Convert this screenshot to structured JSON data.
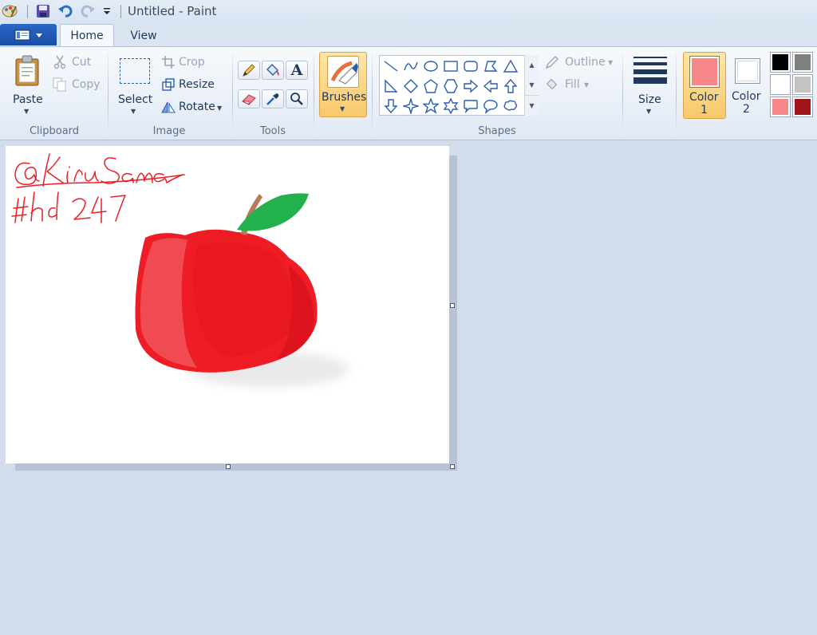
{
  "window": {
    "title": "Untitled - Paint"
  },
  "tabs": [
    {
      "label": "Home"
    },
    {
      "label": "View"
    }
  ],
  "clipboard": {
    "group_label": "Clipboard",
    "paste_label": "Paste",
    "cut_label": "Cut",
    "copy_label": "Copy"
  },
  "image": {
    "group_label": "Image",
    "select_label": "Select",
    "crop_label": "Crop",
    "resize_label": "Resize",
    "rotate_label": "Rotate"
  },
  "tools": {
    "group_label": "Tools"
  },
  "brushes": {
    "label": "Brushes"
  },
  "shapes": {
    "group_label": "Shapes",
    "outline_label": "Outline",
    "fill_label": "Fill"
  },
  "size": {
    "label": "Size"
  },
  "colors": {
    "color1": {
      "label_line1": "Color",
      "label_line2": "1",
      "value": "#f7868a"
    },
    "color2": {
      "label_line1": "Color",
      "label_line2": "2",
      "value": "#ffffff"
    },
    "palette": [
      "#000000",
      "#7f7f7f",
      "#ffffff",
      "#c3c3c3",
      "#f7868a",
      "#a0141c"
    ]
  },
  "canvas": {
    "signature_line1": "@KiruSama",
    "signature_line2": "#hd247",
    "apple_color": "#ee1c24",
    "leaf_color": "#22b14c",
    "stem_color": "#b97a57"
  }
}
